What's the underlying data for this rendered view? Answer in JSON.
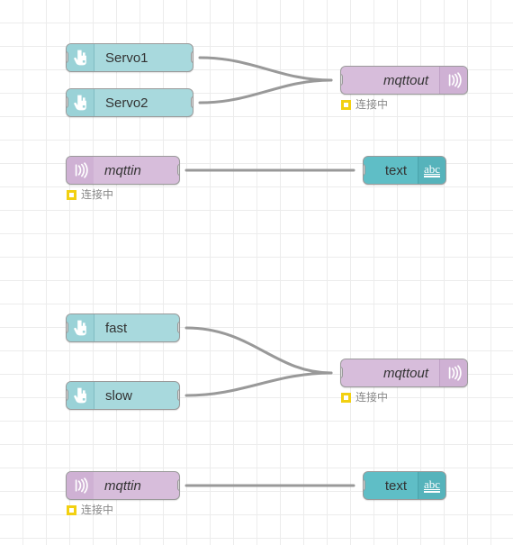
{
  "canvas": {
    "grid_color": "#ececec",
    "background": "#ffffff",
    "wire_color": "#999999"
  },
  "palette": {
    "inject_node": "#a8d9dd",
    "inject_icon_panel": "#9ad2d7",
    "mqtt_node": "#d7bddb",
    "mqtt_icon_panel": "#cfb1d4",
    "text_node": "#5fbec6",
    "text_icon_panel": "#56b3bb",
    "status_yellow": "#f2d011",
    "port_fill": "#d9d9d9",
    "node_border": "#9a9a9a"
  },
  "nodes": {
    "servo1": {
      "label": "Servo1",
      "icon": "hand-pointer-icon"
    },
    "servo2": {
      "label": "Servo2",
      "icon": "hand-pointer-icon"
    },
    "mqttout_top": {
      "label": "mqttout",
      "icon": "broadcast-icon",
      "status": "连接中"
    },
    "mqttin_top": {
      "label": "mqttin",
      "icon": "broadcast-icon",
      "status": "连接中"
    },
    "text_top": {
      "label": "text",
      "icon": "abc-icon",
      "icon_text": "abc"
    },
    "fast": {
      "label": "fast",
      "icon": "hand-pointer-icon"
    },
    "slow": {
      "label": "slow",
      "icon": "hand-pointer-icon"
    },
    "mqttout_bottom": {
      "label": "mqttout",
      "icon": "broadcast-icon",
      "status": "连接中"
    },
    "mqttin_bottom": {
      "label": "mqttin",
      "icon": "broadcast-icon",
      "status": "连接中"
    },
    "text_bottom": {
      "label": "text",
      "icon": "abc-icon",
      "icon_text": "abc"
    }
  }
}
